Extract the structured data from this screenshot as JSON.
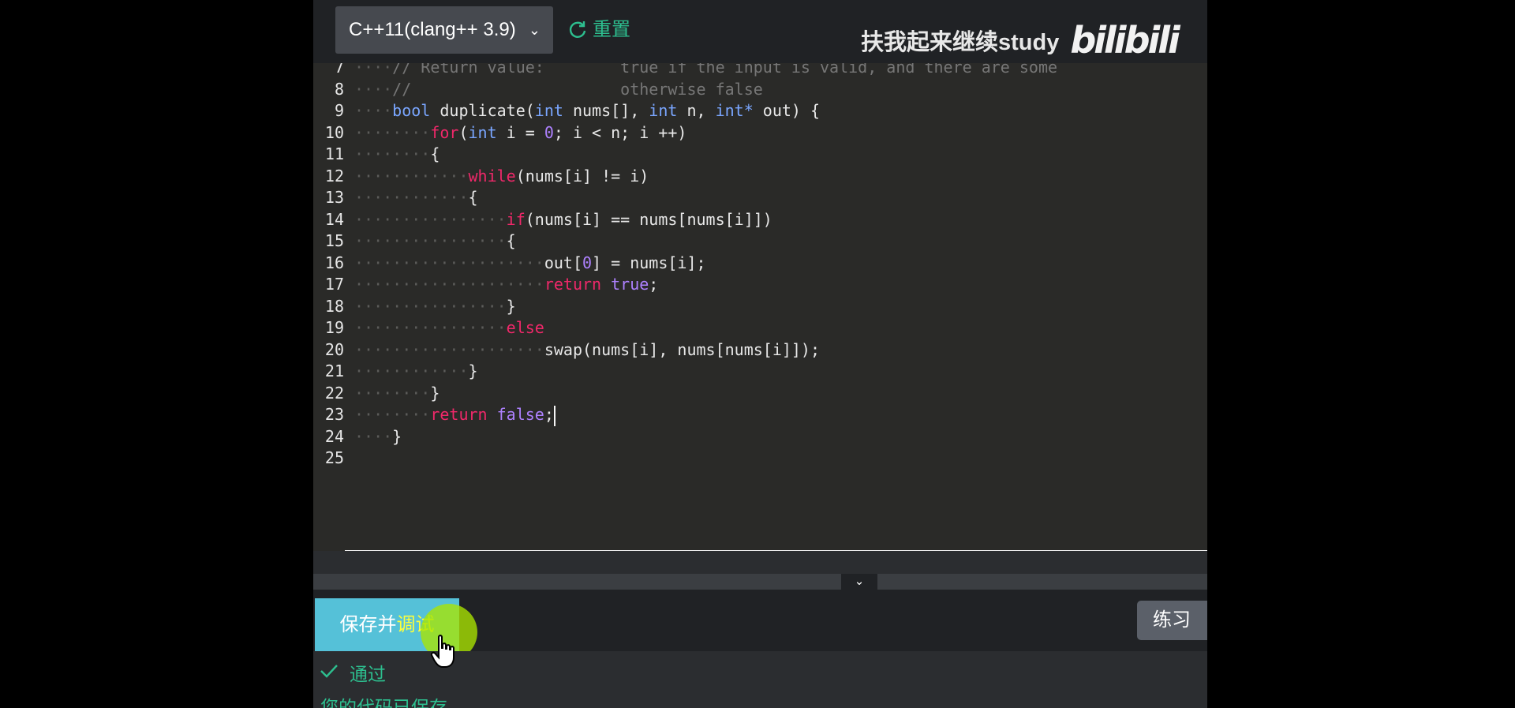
{
  "toolbar": {
    "language": "C++11(clang++ 3.9)",
    "reset_label": "重置",
    "watermark_text": "扶我起来继续study",
    "brand_logo": "bilibili"
  },
  "editor": {
    "lines": [
      {
        "num": "7",
        "ws": "····",
        "parts": [
          [
            "cm",
            "// Return value:        true if the input is valid, and there are some"
          ]
        ]
      },
      {
        "num": "8",
        "ws": "····",
        "parts": [
          [
            "cm",
            "//                      otherwise false"
          ]
        ]
      },
      {
        "num": "9",
        "ws": "····",
        "parts": [
          [
            "ty",
            "bool"
          ],
          [
            "",
            " duplicate("
          ],
          [
            "ty",
            "int"
          ],
          [
            "",
            " nums[], "
          ],
          [
            "ty",
            "int"
          ],
          [
            "",
            " n, "
          ],
          [
            "ty",
            "int*"
          ],
          [
            "",
            " out) {"
          ]
        ]
      },
      {
        "num": "10",
        "ws": "········",
        "parts": [
          [
            "kw",
            "for"
          ],
          [
            "",
            "("
          ],
          [
            "ty",
            "int"
          ],
          [
            "",
            " i = "
          ],
          [
            "nu",
            "0"
          ],
          [
            "",
            "; i < n; i ++)"
          ]
        ]
      },
      {
        "num": "11",
        "ws": "········",
        "parts": [
          [
            "",
            "{"
          ]
        ]
      },
      {
        "num": "12",
        "ws": "············",
        "parts": [
          [
            "kw",
            "while"
          ],
          [
            "",
            "(nums[i] != i)"
          ]
        ]
      },
      {
        "num": "13",
        "ws": "············",
        "parts": [
          [
            "",
            "{"
          ]
        ]
      },
      {
        "num": "14",
        "ws": "················",
        "parts": [
          [
            "kw",
            "if"
          ],
          [
            "",
            "(nums[i] == nums[nums[i]])"
          ]
        ]
      },
      {
        "num": "15",
        "ws": "················",
        "parts": [
          [
            "",
            "{"
          ]
        ]
      },
      {
        "num": "16",
        "ws": "····················",
        "parts": [
          [
            "",
            "out["
          ],
          [
            "nu",
            "0"
          ],
          [
            "",
            "] = nums[i];"
          ]
        ]
      },
      {
        "num": "17",
        "ws": "····················",
        "parts": [
          [
            "kw",
            "return"
          ],
          [
            "",
            " "
          ],
          [
            "bl",
            "true"
          ],
          [
            "",
            ";"
          ]
        ]
      },
      {
        "num": "18",
        "ws": "················",
        "parts": [
          [
            "",
            "}"
          ]
        ]
      },
      {
        "num": "19",
        "ws": "················",
        "parts": [
          [
            "kw",
            "else"
          ]
        ]
      },
      {
        "num": "20",
        "ws": "····················",
        "parts": [
          [
            "",
            "swap(nums[i], nums[nums[i]]);"
          ]
        ]
      },
      {
        "num": "21",
        "ws": "············",
        "parts": [
          [
            "",
            "}"
          ]
        ]
      },
      {
        "num": "22",
        "ws": "········",
        "parts": [
          [
            "",
            "}"
          ]
        ]
      },
      {
        "num": "23",
        "ws": "········",
        "parts": [
          [
            "kw",
            "return"
          ],
          [
            "",
            " "
          ],
          [
            "bl",
            "false"
          ],
          [
            "",
            ";"
          ]
        ],
        "cursor": true
      },
      {
        "num": "24",
        "ws": "····",
        "parts": [
          [
            "",
            "}"
          ]
        ]
      },
      {
        "num": "25",
        "ws": "",
        "parts": []
      }
    ],
    "scroll_left_arrow": "◂",
    "collapse_arrow": "⌄"
  },
  "actions": {
    "save_debug_label_a": "保存并",
    "save_debug_label_b": "调试",
    "practice_label": "练习"
  },
  "result": {
    "status_label": "通过",
    "save_message": "您的代码已保存"
  },
  "colors": {
    "accent": "#2dbf8f",
    "button_primary": "#55c1d8",
    "keyword": "#f0286a",
    "type": "#7aa6ff",
    "literal": "#ae81ff",
    "comment": "#767676"
  }
}
